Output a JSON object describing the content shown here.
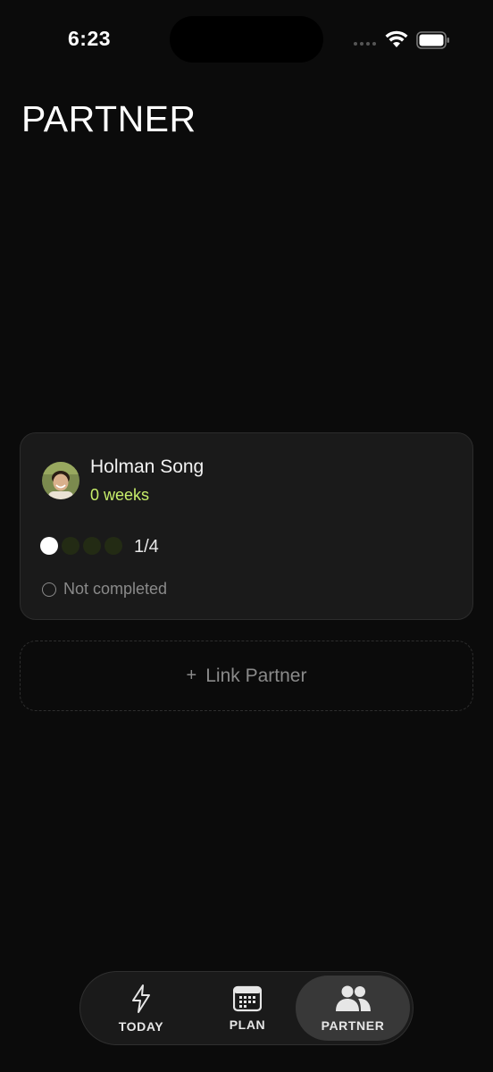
{
  "status_bar": {
    "time": "6:23"
  },
  "page": {
    "title": "PARTNER"
  },
  "partner_card": {
    "name": "Holman Song",
    "weeks": "0 weeks",
    "progress": {
      "completed": 1,
      "total": 4,
      "label": "1/4"
    },
    "status": "Not completed",
    "accent_color": "#c7ee6a"
  },
  "link_partner": {
    "plus": "+",
    "label": "Link Partner"
  },
  "tabbar": {
    "tabs": [
      {
        "label": "TODAY",
        "icon": "lightning-icon",
        "active": false
      },
      {
        "label": "PLAN",
        "icon": "calendar-icon",
        "active": false
      },
      {
        "label": "PARTNER",
        "icon": "people-icon",
        "active": true
      }
    ]
  }
}
